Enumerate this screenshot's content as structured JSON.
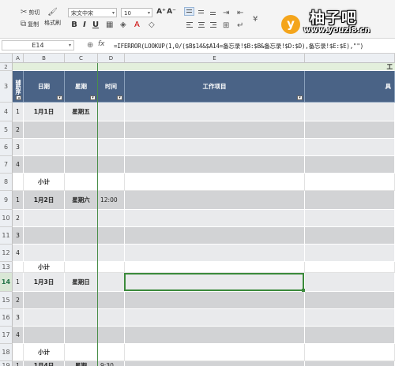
{
  "toolbar": {
    "cut": "剪切",
    "copy": "复制",
    "format_painter": "格式刷",
    "font_name": "宋文中宋",
    "font_size": "10",
    "bold": "B",
    "italic": "I",
    "underline": "U",
    "font_grow": "A⁺",
    "font_shrink": "A⁻"
  },
  "logo": {
    "badge": "y",
    "brand": "柚子吧",
    "url": "www.youzi8.cn"
  },
  "formula_bar": {
    "name_box": "E14",
    "fx": "fx",
    "formula": "=IFERROR(LOOKUP(1,0/($B$14&$A14=备忘录!$B:$B&备忘录!$D:$D),备忘录!$E:$E),\"\")"
  },
  "columns": [
    "A",
    "B",
    "C",
    "D",
    "E"
  ],
  "header_row": {
    "helper": "辅助序",
    "date": "日期",
    "weekday": "星期",
    "time": "时间",
    "work": "工作项目",
    "extra": "具"
  },
  "row2_label": "工",
  "rows": [
    {
      "num": "4",
      "a": "1",
      "b": "1月1日",
      "c": "星期五",
      "d": ""
    },
    {
      "num": "5",
      "a": "2",
      "b": "",
      "c": "",
      "d": ""
    },
    {
      "num": "6",
      "a": "3",
      "b": "",
      "c": "",
      "d": ""
    },
    {
      "num": "7",
      "a": "4",
      "b": "",
      "c": "",
      "d": ""
    },
    {
      "num": "8",
      "a": "",
      "b": "小计",
      "c": "",
      "d": ""
    },
    {
      "num": "9",
      "a": "1",
      "b": "1月2日",
      "c": "星期六",
      "d": "12:00"
    },
    {
      "num": "10",
      "a": "2",
      "b": "",
      "c": "",
      "d": ""
    },
    {
      "num": "11",
      "a": "3",
      "b": "",
      "c": "",
      "d": ""
    },
    {
      "num": "12",
      "a": "4",
      "b": "",
      "c": "",
      "d": ""
    },
    {
      "num": "13",
      "a": "",
      "b": "小计",
      "c": "",
      "d": ""
    },
    {
      "num": "14",
      "a": "1",
      "b": "1月3日",
      "c": "星期日",
      "d": ""
    },
    {
      "num": "15",
      "a": "2",
      "b": "",
      "c": "",
      "d": ""
    },
    {
      "num": "16",
      "a": "3",
      "b": "",
      "c": "",
      "d": ""
    },
    {
      "num": "17",
      "a": "4",
      "b": "",
      "c": "",
      "d": ""
    },
    {
      "num": "18",
      "a": "",
      "b": "小计",
      "c": "",
      "d": ""
    },
    {
      "num": "19",
      "a": "1",
      "b": "1月4日",
      "c": "星期",
      "d": "9:30"
    }
  ],
  "selected_row": "14",
  "selected_cell": "E14"
}
